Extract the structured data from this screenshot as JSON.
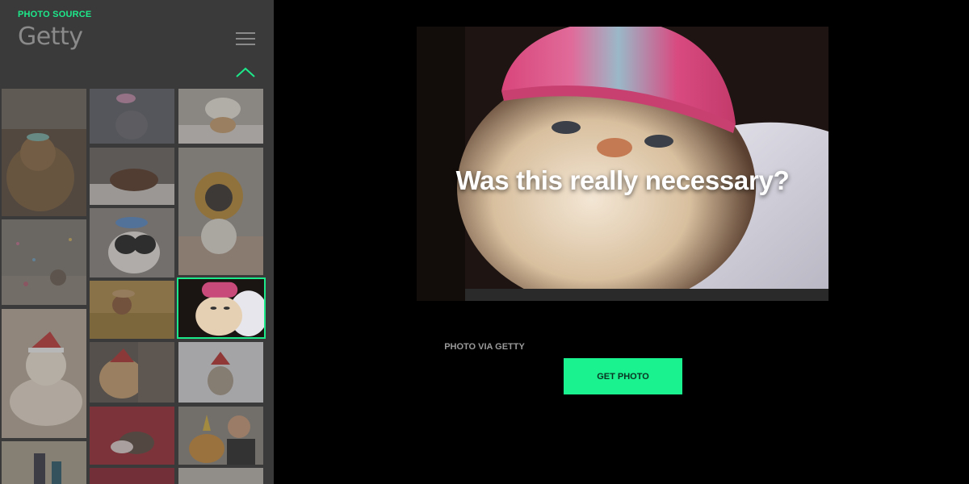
{
  "sidebar": {
    "source_label": "PHOTO SOURCE",
    "source_name": "Getty",
    "accent": "#1de98b",
    "menu_icon": "hamburger-menu-icon",
    "collapse_icon": "chevron-up-icon"
  },
  "main": {
    "caption": "Was this really necessary?",
    "via_text": "PHOTO VIA GETTY",
    "button_label": "GET PHOTO",
    "button_color": "#19f28f"
  }
}
